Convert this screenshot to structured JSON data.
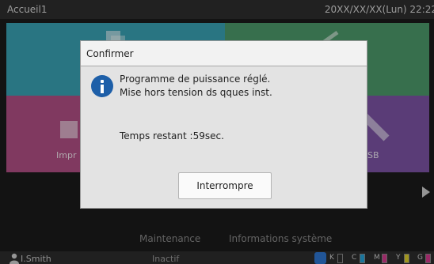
{
  "topbar": {
    "home_label": "Accueil1",
    "datetime": "20XX/XX/XX(Lun) 22:22"
  },
  "tiles": {
    "copy": {
      "color": "#3aa3b5",
      "icon": "copy-icon"
    },
    "scan": {
      "color": "#4d9a6b",
      "icon": "scan-icon"
    },
    "print": {
      "label": "Impr",
      "color": "#b24f86",
      "icon": "print-icon"
    },
    "usb": {
      "label": "SB",
      "color": "#7d54a6",
      "icon": "usb-icon"
    }
  },
  "bottom_menu": {
    "items": [
      "Maintenance",
      "Informations système"
    ]
  },
  "statusbar": {
    "user": "I.Smith",
    "state": "Inactif",
    "inks": [
      {
        "letter": "K",
        "color": "#2d2d2d",
        "level": 0
      },
      {
        "letter": "C",
        "color": "#25a3d8",
        "level": 1
      },
      {
        "letter": "M",
        "color": "#d63a8e",
        "level": 1
      },
      {
        "letter": "Y",
        "color": "#e0cf2a",
        "level": 1
      },
      {
        "letter": "G",
        "color": "#d63a8e",
        "level": 1
      }
    ]
  },
  "dialog": {
    "title": "Confirmer",
    "icon": "info-icon",
    "message_line1": "Programme de puissance réglé.",
    "message_line2": "Mise hors tension ds qques inst.",
    "remaining": "Temps restant :59sec.",
    "button_label": "Interrompre"
  },
  "colors": {
    "accent": "#1e5fa8",
    "dialog_bg": "#e3e3e3"
  }
}
